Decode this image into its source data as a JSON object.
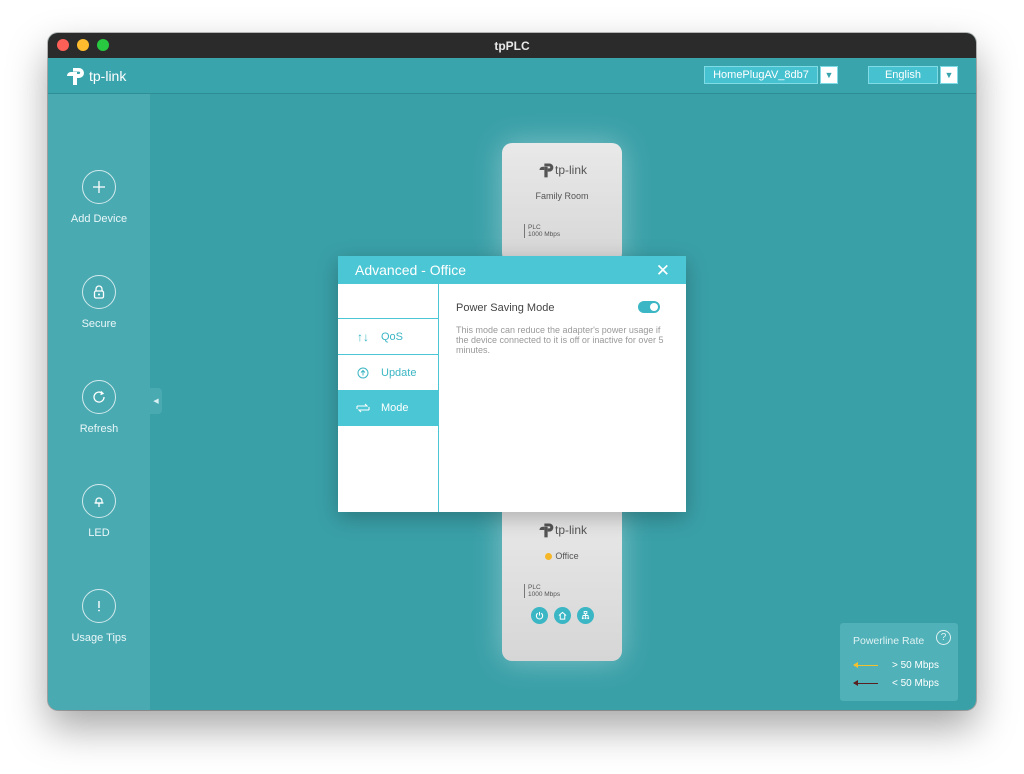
{
  "window": {
    "title": "tpPLC"
  },
  "brand": {
    "logo_text": "tp-link"
  },
  "header": {
    "network": {
      "selected": "HomePlugAV_8db7"
    },
    "language": {
      "selected": "English"
    }
  },
  "sidebar": {
    "items": [
      {
        "id": "add-device",
        "label": "Add Device",
        "icon": "plus-icon"
      },
      {
        "id": "secure",
        "label": "Secure",
        "icon": "lock-icon"
      },
      {
        "id": "refresh",
        "label": "Refresh",
        "icon": "refresh-icon"
      },
      {
        "id": "led",
        "label": "LED",
        "icon": "bulb-icon"
      },
      {
        "id": "usage-tips",
        "label": "Usage Tips",
        "icon": "exclamation-icon"
      }
    ]
  },
  "devices": {
    "top": {
      "logo_text": "tp-link",
      "name": "Family Room",
      "plc_line1": "PLC",
      "plc_line2": "1000 Mbps"
    },
    "bottom": {
      "logo_text": "tp-link",
      "name": "Office",
      "plc_line1": "PLC",
      "plc_line2": "1000 Mbps"
    }
  },
  "modal": {
    "title": "Advanced - Office",
    "nav": [
      {
        "label": "QoS",
        "icon": "sort-arrows-icon"
      },
      {
        "label": "Update",
        "icon": "update-icon"
      },
      {
        "label": "Mode",
        "icon": "mode-switch-icon",
        "active": true
      }
    ],
    "power_saving": {
      "title": "Power Saving Mode",
      "enabled": true,
      "description": "This mode can reduce the adapter's power usage if the device connected to it is off or inactive for over 5 minutes."
    }
  },
  "legend": {
    "title": "Powerline Rate",
    "rows": [
      {
        "label": "> 50 Mbps",
        "color": "#f2c12e"
      },
      {
        "label": "< 50 Mbps",
        "color": "#5a1f1f"
      }
    ]
  },
  "colors": {
    "accent": "#4bc6d4",
    "background": "#3aa0a8",
    "status_dot": "#f5b728"
  }
}
